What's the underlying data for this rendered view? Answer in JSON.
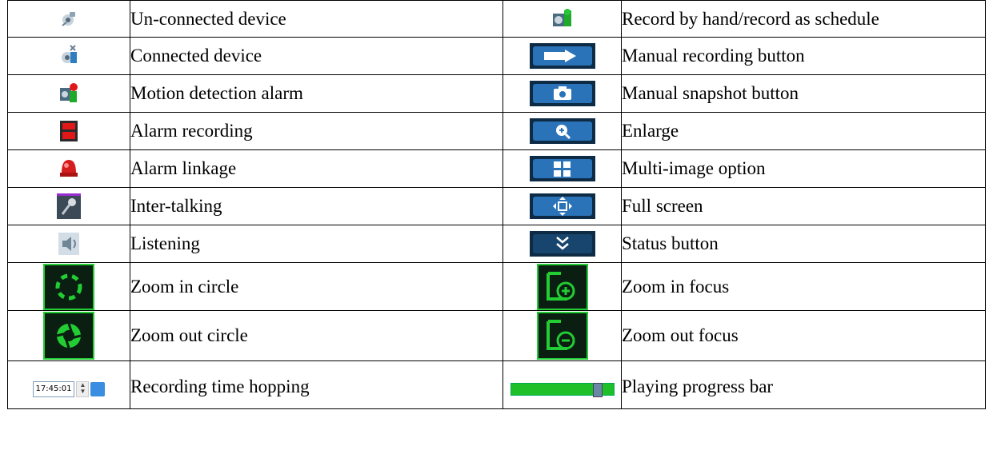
{
  "rows": [
    {
      "left_icon": "unconnected-device-icon",
      "left_label": "Un-connected device",
      "right_icon": "record-schedule-icon",
      "right_label": "Record by hand/record as schedule"
    },
    {
      "left_icon": "connected-device-icon",
      "left_label": "Connected device",
      "right_icon": "manual-record-icon",
      "right_label": "Manual recording button"
    },
    {
      "left_icon": "motion-alarm-icon",
      "left_label": "Motion detection alarm",
      "right_icon": "snapshot-icon",
      "right_label": "Manual snapshot button"
    },
    {
      "left_icon": "alarm-recording-icon",
      "left_label": "Alarm recording",
      "right_icon": "enlarge-icon",
      "right_label": "Enlarge"
    },
    {
      "left_icon": "alarm-linkage-icon",
      "left_label": "Alarm linkage",
      "right_icon": "multi-image-icon",
      "right_label": "Multi-image option"
    },
    {
      "left_icon": "microphone-icon",
      "left_label": "Inter-talking",
      "right_icon": "full-screen-icon",
      "right_label": "Full screen"
    },
    {
      "left_icon": "speaker-icon",
      "left_label": "Listening",
      "right_icon": "status-icon",
      "right_label": "Status button"
    },
    {
      "left_icon": "zoom-in-circle-icon",
      "left_label": "Zoom in circle",
      "right_icon": "zoom-in-focus-icon",
      "right_label": "Zoom in focus"
    },
    {
      "left_icon": "zoom-out-circle-icon",
      "left_label": "Zoom out circle",
      "right_icon": "zoom-out-focus-icon",
      "right_label": "Zoom out focus"
    }
  ],
  "last_row": {
    "left_label": "Recording time hopping",
    "time_value": "17:45:01",
    "right_label": "Playing progress bar",
    "progress": 0.85
  },
  "colors": {
    "green": "#22cc33",
    "dark_bg": "#0b1e12",
    "button_blue": "#2a73b8",
    "alarm_red": "#e01818"
  }
}
